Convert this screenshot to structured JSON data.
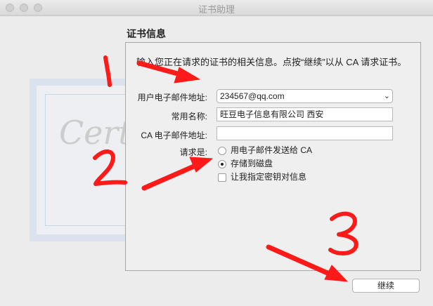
{
  "window": {
    "title": "证书助理"
  },
  "section": {
    "heading": "证书信息"
  },
  "intro": "输入您正在请求的证书的相关信息。点按“继续”以从 CA 请求证书。",
  "form": {
    "email_label": "用户电子邮件地址:",
    "email_value": "234567@qq.com",
    "name_label": "常用名称:",
    "name_value": "旺豆电子信息有限公司 西安",
    "ca_email_label": "CA 电子邮件地址:",
    "ca_email_value": "",
    "request_label": "请求是:",
    "request_options": [
      "用电子邮件发送给 CA",
      "存储到磁盘"
    ],
    "request_selected": "存储到磁盘",
    "keypair_checkbox": "让我指定密钥对信息",
    "keypair_checked": false
  },
  "continue_button": "继续",
  "background_art": "Certified",
  "annotations": {
    "color": "#ff1a1a",
    "numbers": [
      "1",
      "2",
      "3"
    ]
  }
}
